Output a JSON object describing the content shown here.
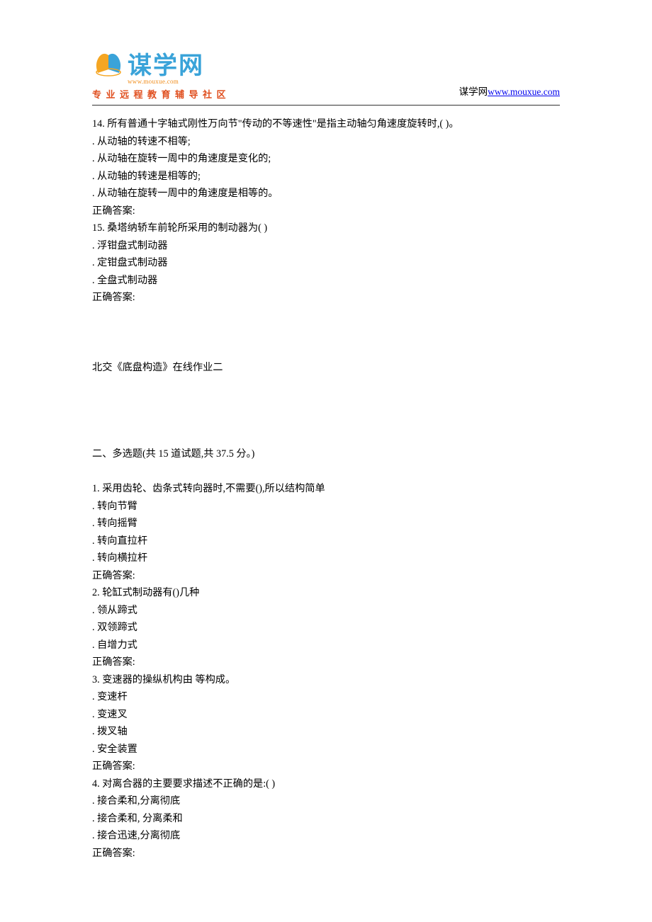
{
  "header": {
    "logo_text": "谋学网",
    "logo_url_small": "www.mouxue.com",
    "tagline": "专业远程教育辅导社区",
    "right_label": "谋学网",
    "right_link": "www.mouxue.com"
  },
  "questions_p1": [
    {
      "num": "14.",
      "text": "所有普通十字轴式刚性万向节\"传动的不等速性\"是指主动轴匀角速度旋转时,(  )。",
      "opts": [
        ". 从动轴的转速不相等;",
        ". 从动轴在旋转一周中的角速度是变化的;",
        ". 从动轴的转速是相等的;",
        ". 从动轴在旋转一周中的角速度是相等的。"
      ],
      "ans": "正确答案:"
    },
    {
      "num": "15.",
      "text": "桑塔纳轿车前轮所采用的制动器为(  )",
      "opts": [
        ". 浮钳盘式制动器",
        ". 定钳盘式制动器",
        ". 全盘式制动器"
      ],
      "ans": "正确答案:"
    }
  ],
  "section_title": "北交《底盘构造》在线作业二",
  "section_sub": "二、多选题(共 15 道试题,共 37.5 分。)",
  "questions_p2": [
    {
      "num": "1.",
      "text": "采用齿轮、齿条式转向器时,不需要(),所以结构简单",
      "opts": [
        ". 转向节臂",
        ". 转向摇臂",
        ". 转向直拉杆",
        ". 转向横拉杆"
      ],
      "ans": "正确答案:"
    },
    {
      "num": "2.",
      "text": "轮缸式制动器有()几种",
      "opts": [
        ". 领从蹄式",
        ". 双领蹄式",
        ". 自增力式"
      ],
      "ans": "正确答案:"
    },
    {
      "num": "3.",
      "text": "变速器的操纵机构由 等构成。",
      "opts": [
        ". 变速杆",
        ". 变速叉",
        ". 拨叉轴",
        ". 安全装置"
      ],
      "ans": "正确答案:"
    },
    {
      "num": "4.",
      "text": "对离合器的主要要求描述不正确的是:(    )",
      "opts": [
        ". 接合柔和,分离彻底",
        ". 接合柔和, 分离柔和",
        ". 接合迅速,分离彻底"
      ],
      "ans": "正确答案:"
    }
  ]
}
